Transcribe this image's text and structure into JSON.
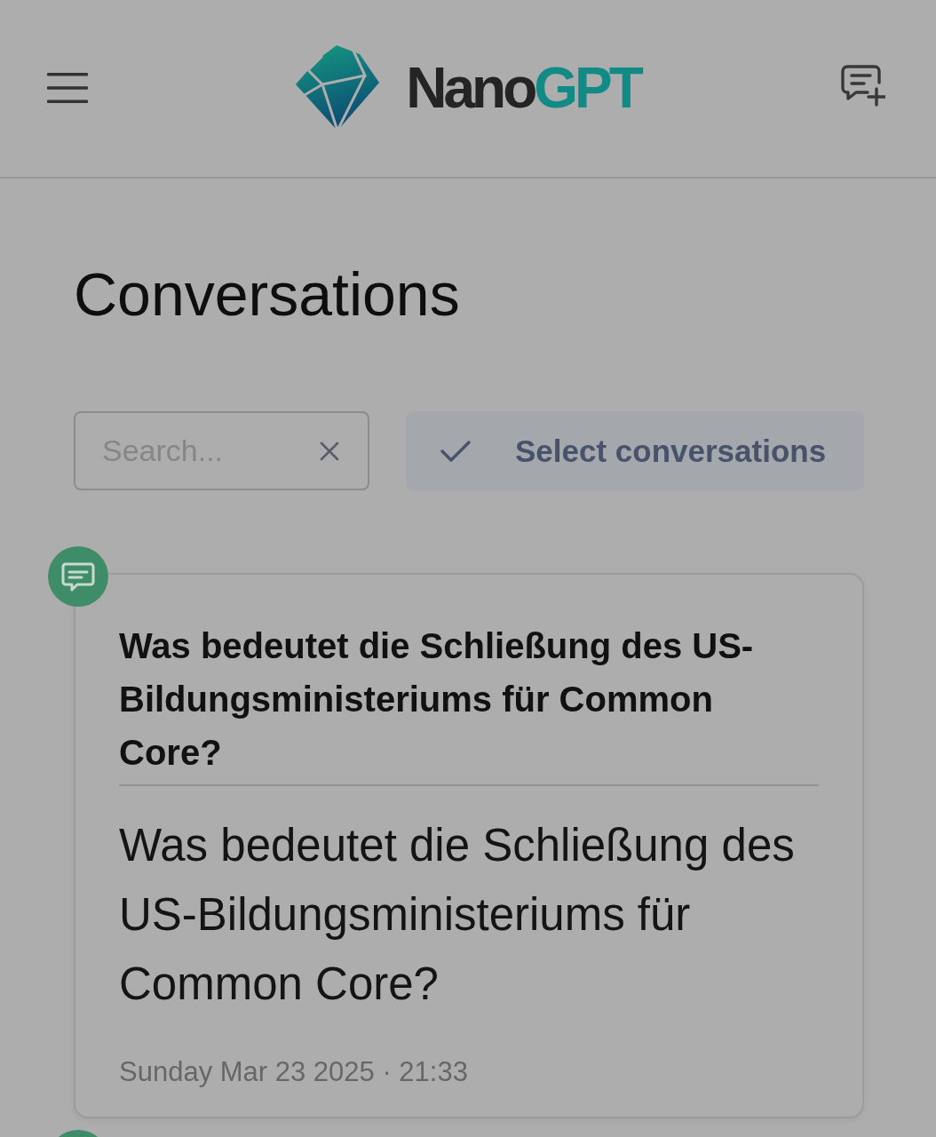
{
  "header": {
    "logo": {
      "name": "Nano",
      "accent": "GPT"
    }
  },
  "page_title": "Conversations",
  "search": {
    "placeholder": "Search..."
  },
  "select_button": {
    "label": "Select conversations"
  },
  "conversations": [
    {
      "kind": "chat",
      "title": "Was bedeutet die Schließung des US-Bildungsministeriums für Common Core?",
      "preview": "Was bedeutet die Schließung des US-Bildungsministeriums für Common Core?",
      "date": "Sunday Mar 23 2025 · 21:33"
    },
    {
      "kind": "chat"
    }
  ]
}
